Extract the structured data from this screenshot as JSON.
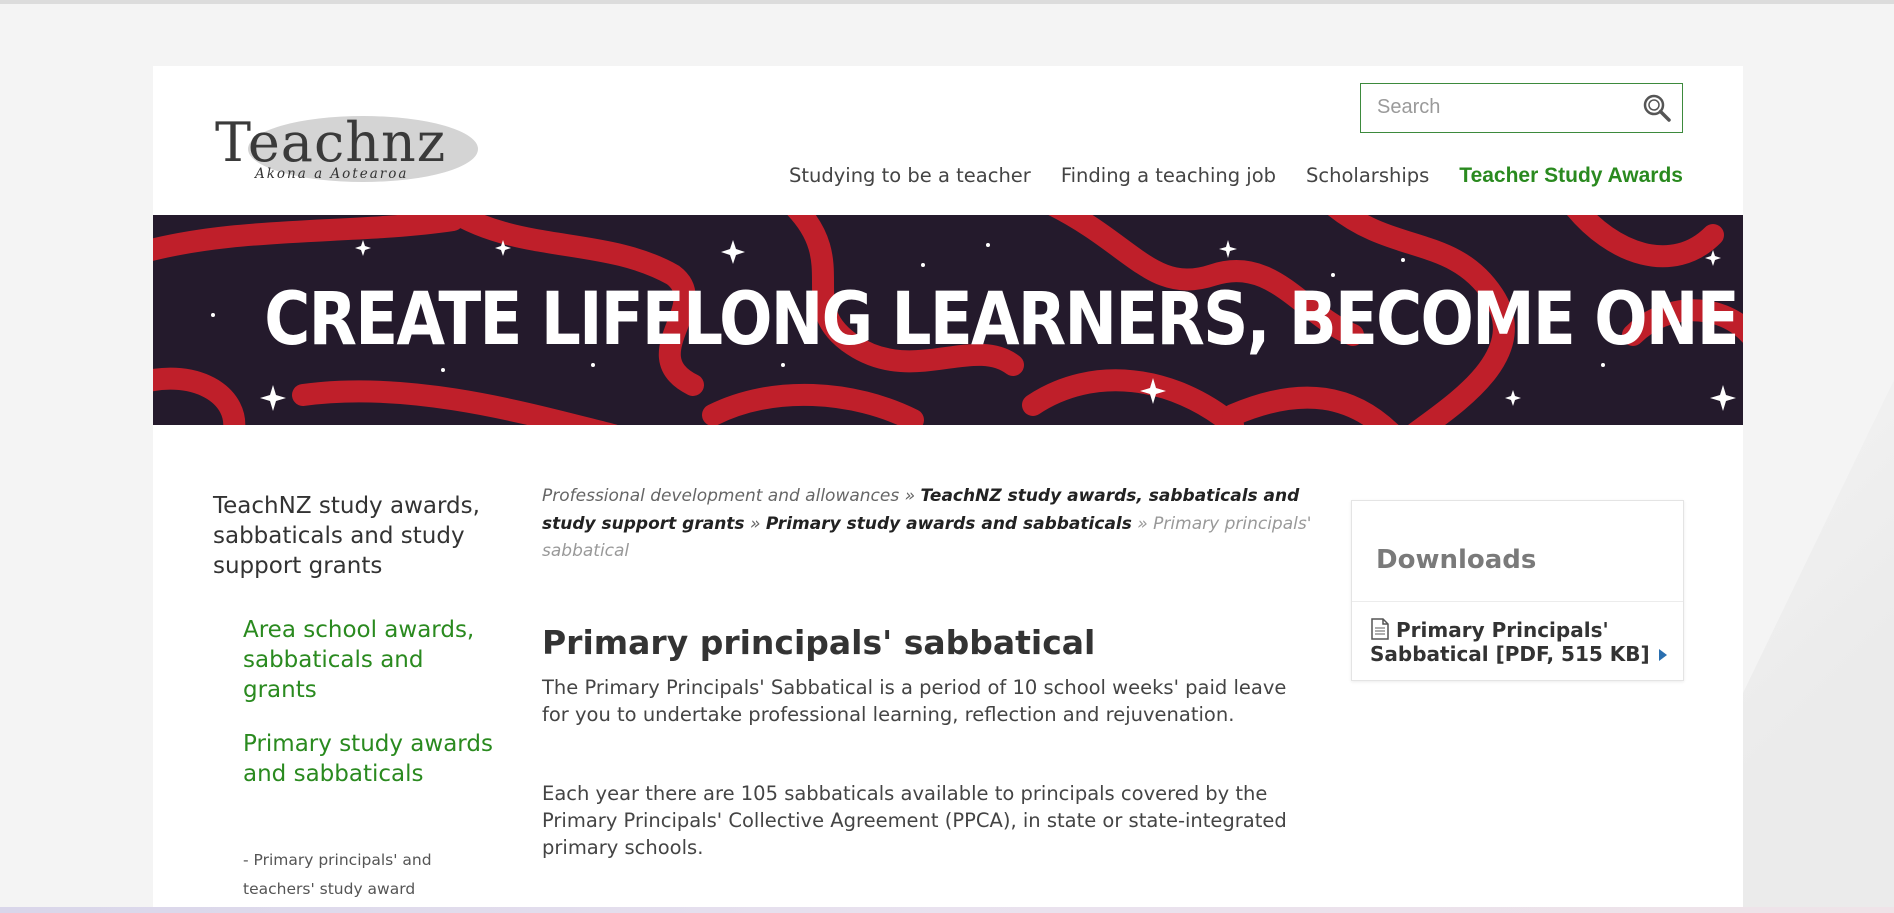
{
  "header": {
    "logo": {
      "wordmark": "Teachnz",
      "tagline": "Akona a Aotearoa"
    },
    "search": {
      "placeholder": "Search",
      "value": "",
      "icon": "search-icon"
    },
    "nav": [
      {
        "label": "Studying to be a teacher",
        "active": false
      },
      {
        "label": "Finding a teaching job",
        "active": false
      },
      {
        "label": "Scholarships",
        "active": false
      },
      {
        "label": "Teacher Study Awards",
        "active": true
      }
    ],
    "accent_color": "#2a8a1f"
  },
  "banner": {
    "title": "CREATE LIFELONG LEARNERS, BECOME ONE YOURSELF",
    "background_color": "#241a2c",
    "ribbon_color": "#c8202a"
  },
  "sidebar": {
    "title": "TeachNZ study awards, sabbaticals and study support grants",
    "links": [
      "Area school awards, sabbaticals and grants",
      "Primary study awards and sabbaticals"
    ],
    "sub_item": "- Primary principals' and teachers' study award"
  },
  "breadcrumb": {
    "items": [
      {
        "label": "Professional development and allowances",
        "bold": false
      },
      {
        "label": "TeachNZ study awards, sabbaticals and study support grants",
        "bold": true
      },
      {
        "label": "Primary study awards and sabbaticals",
        "bold": true
      }
    ],
    "separator": "»",
    "current": "Primary principals' sabbatical"
  },
  "main": {
    "title": "Primary principals' sabbatical",
    "paragraphs": [
      "The Primary Principals' Sabbatical is a period of 10 school weeks' paid leave for you to undertake professional learning, reflection and rejuvenation.",
      "Each year there are 105 sabbaticals available to principals covered by the Primary Principals' Collective Agreement (PPCA), in state or state-integrated primary schools."
    ]
  },
  "downloads": {
    "title": "Downloads",
    "items": [
      {
        "label": "Primary Principals' Sabbatical [PDF, 515 KB]",
        "icon": "document-icon"
      }
    ]
  }
}
